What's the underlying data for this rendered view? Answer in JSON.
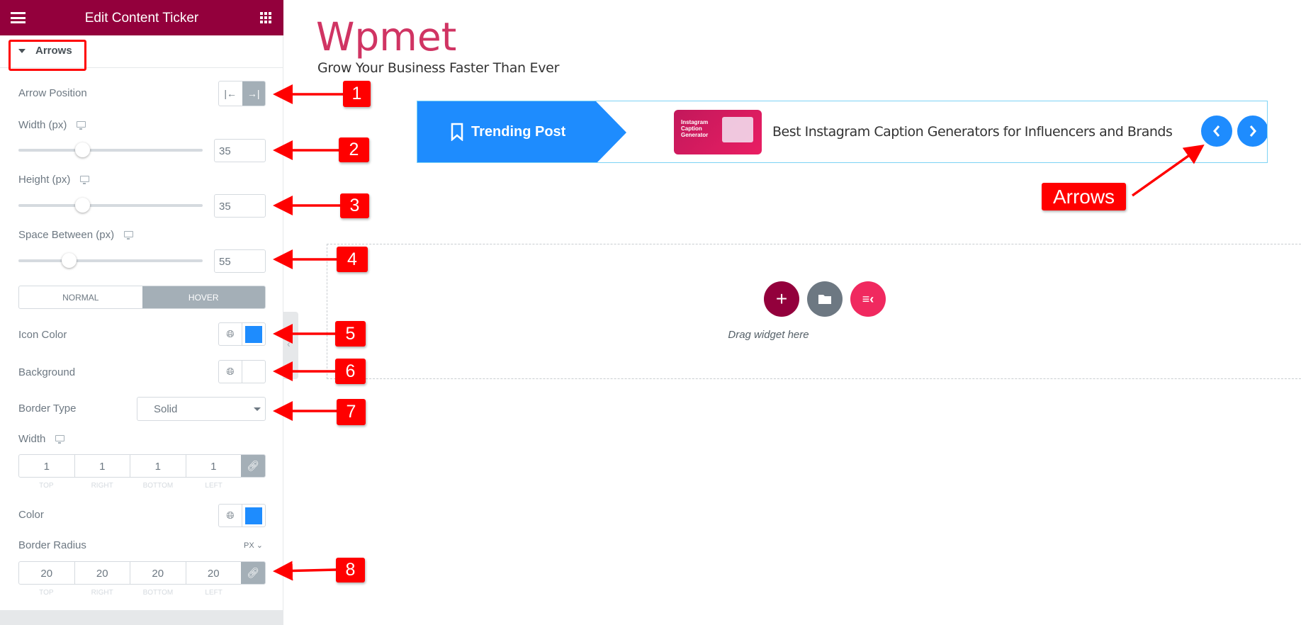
{
  "sidebar": {
    "title": "Edit Content Ticker",
    "section": "Arrows",
    "arrow_position": {
      "label": "Arrow Position",
      "selected": "right"
    },
    "width": {
      "label": "Width (px)",
      "value": "35",
      "slider_percent": 35
    },
    "height": {
      "label": "Height (px)",
      "value": "35",
      "slider_percent": 35
    },
    "space_between": {
      "label": "Space Between (px)",
      "value": "55",
      "slider_percent": 27
    },
    "tabs": [
      "NORMAL",
      "HOVER"
    ],
    "active_tab": "HOVER",
    "icon_color": {
      "label": "Icon Color",
      "color": "#1e8cfe"
    },
    "background": {
      "label": "Background"
    },
    "border_type": {
      "label": "Border Type",
      "value": "Solid"
    },
    "border_width": {
      "label": "Width",
      "values": [
        "1",
        "1",
        "1",
        "1"
      ]
    },
    "dim_labels": [
      "TOP",
      "RIGHT",
      "BOTTOM",
      "LEFT"
    ],
    "color": {
      "label": "Color",
      "color": "#1e8cfe"
    },
    "border_radius": {
      "label": "Border Radius",
      "unit": "PX",
      "values": [
        "20",
        "20",
        "20",
        "20"
      ]
    }
  },
  "main": {
    "site_title": "Wpmet",
    "tagline": "Grow Your Business Faster Than Ever",
    "ticker": {
      "label": "Trending Post",
      "post_title": "Best Instagram Caption Generators for Influencers and Brands",
      "thumb_text": [
        "Instagram",
        "Caption",
        "Generator"
      ]
    },
    "drop_zone": {
      "text": "Drag widget here"
    }
  },
  "annotations": {
    "badges": [
      "1",
      "2",
      "3",
      "4",
      "5",
      "6",
      "7",
      "8"
    ],
    "arrows_label": "Arrows"
  },
  "colors": {
    "brand": "#93003c",
    "accent": "#1e8cfe",
    "site_title": "#d03463",
    "annotation": "#ff0000"
  }
}
